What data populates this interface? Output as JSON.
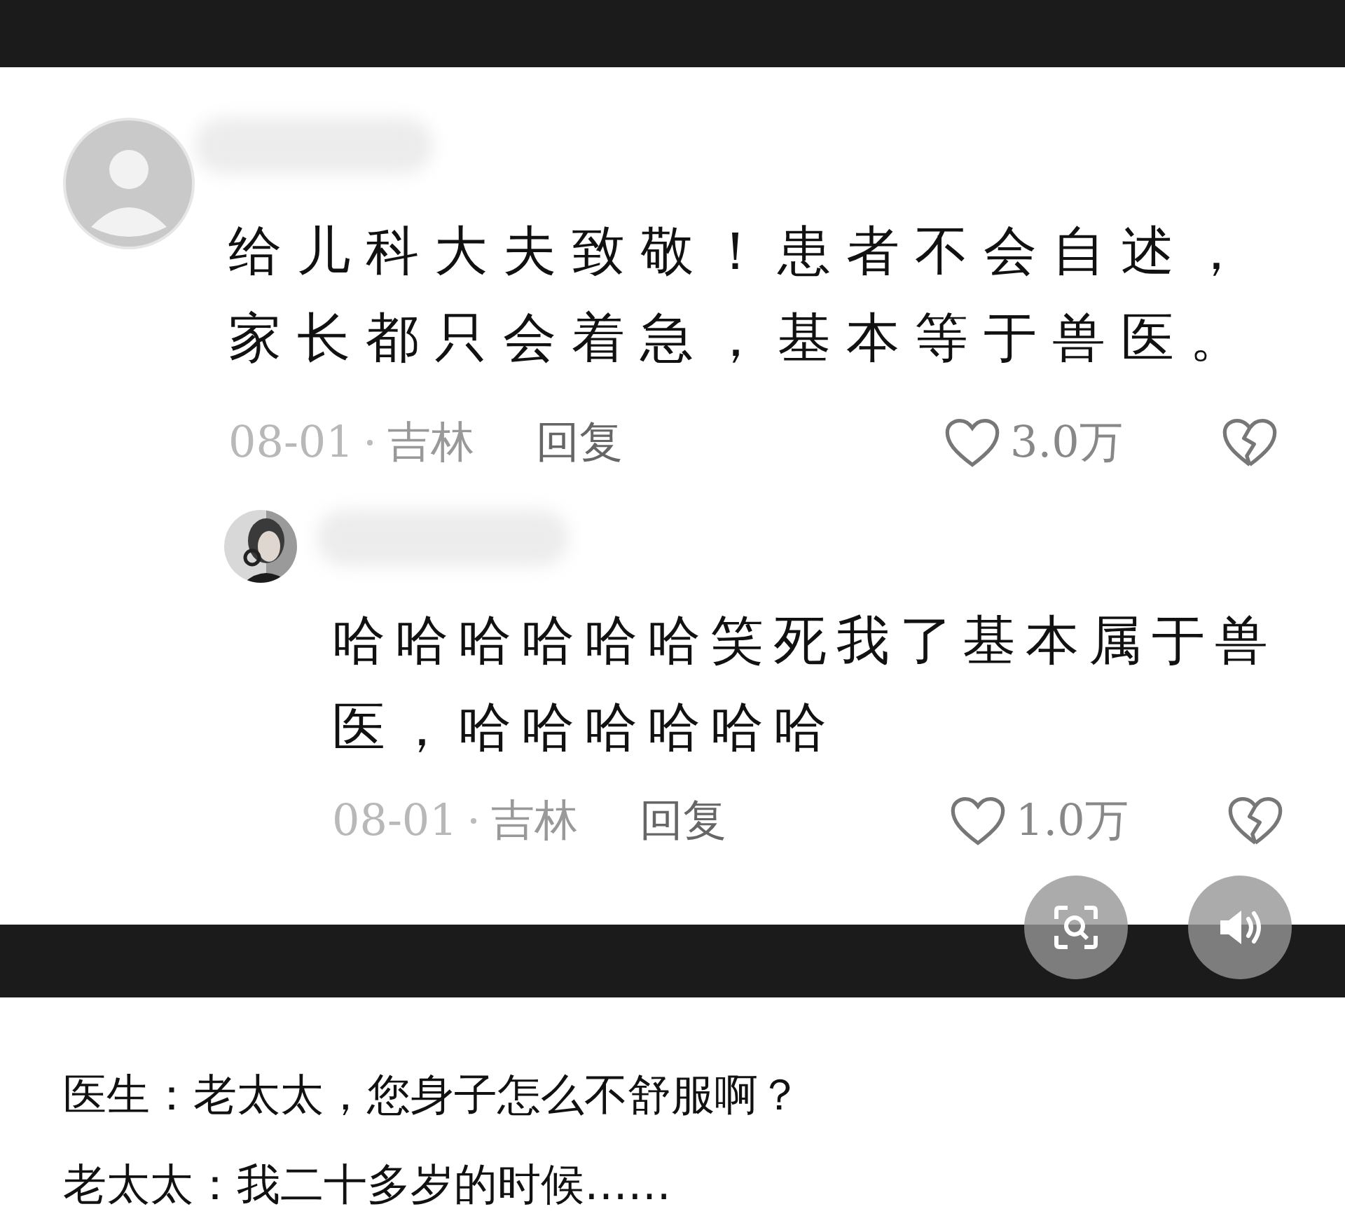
{
  "comments": [
    {
      "text": "给儿科大夫致敬！患者不会自述，家长都只会着急，基本等于兽医。",
      "date": "08-01",
      "location": "吉林",
      "reply_label": "回复",
      "likes": "3.0万",
      "kind": "comment"
    },
    {
      "text": "哈哈哈哈哈哈笑死我了基本属于兽医，哈哈哈哈哈哈",
      "date": "08-01",
      "location": "吉林",
      "reply_label": "回复",
      "likes": "1.0万",
      "kind": "reply"
    }
  ],
  "captions": [
    "医生：老太太，您身子怎么不舒服啊？",
    "老太太：我二十多岁的时候……"
  ]
}
